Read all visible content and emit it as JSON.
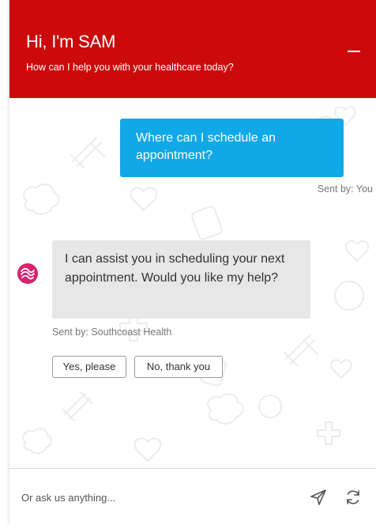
{
  "header": {
    "title": "Hi, I'm SAM",
    "subtitle": "How can I help you with your healthcare today?"
  },
  "messages": [
    {
      "sender": "user",
      "text": "Where can I schedule an appointment?",
      "sent_by": "Sent by: You"
    },
    {
      "sender": "bot",
      "text": "I can assist you in scheduling your next appointment. Would you like my help?",
      "sent_by": "Sent by: Southcoast Health"
    }
  ],
  "quick_replies": [
    "Yes, please",
    "No, thank you"
  ],
  "input": {
    "placeholder": "Or ask us anything..."
  },
  "icons": {
    "minimize": "minimize-icon",
    "bot_avatar": "southcoast-logo-icon",
    "send": "send-icon",
    "refresh": "refresh-icon"
  },
  "colors": {
    "header_bg": "#cc0a0a",
    "user_bubble": "#10a8e6",
    "bot_bubble": "#e7e7e7",
    "avatar": "#d6246e"
  }
}
